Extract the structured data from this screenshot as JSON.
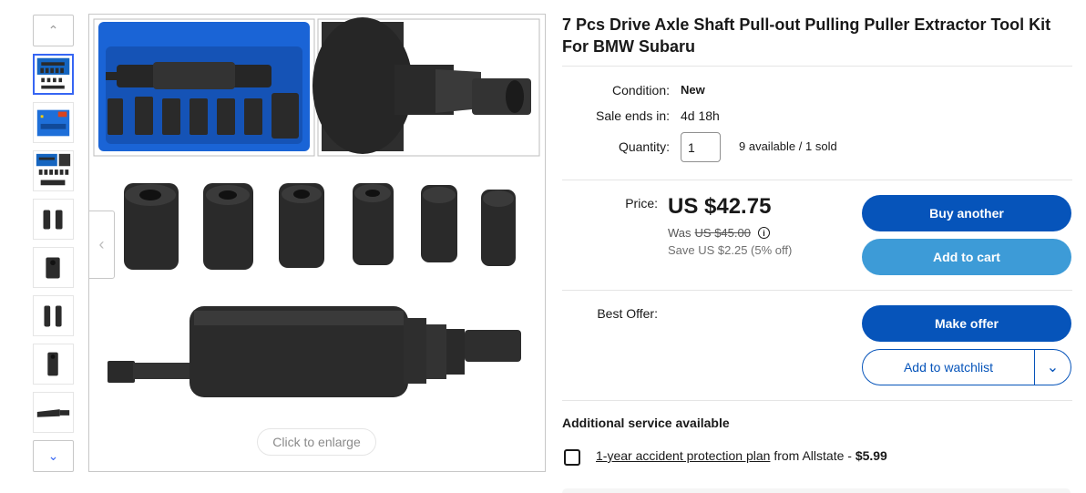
{
  "listing": {
    "title": "7 Pcs Drive Axle Shaft Pull-out Pulling Puller Extractor Tool Kit For BMW Subaru"
  },
  "gallery": {
    "up_icon": "chevron-up-icon",
    "down_icon": "chevron-down-icon",
    "prev_icon": "chevron-left-icon",
    "next_icon": "chevron-right-icon",
    "enlarge_label": "Click to enlarge",
    "thumbnails": [
      "kit-overview",
      "case-blue",
      "case-open",
      "sockets-pair",
      "socket-single",
      "sockets-pair-2",
      "socket-single-2",
      "puller-shaft"
    ]
  },
  "details": {
    "condition_label": "Condition:",
    "condition_value": "New",
    "sale_ends_label": "Sale ends in:",
    "sale_ends_value": "4d 18h",
    "quantity_label": "Quantity:",
    "quantity_value": "1",
    "availability": "9 available / 1 sold"
  },
  "price": {
    "label": "Price:",
    "current": "US $42.75",
    "was_label": "Was",
    "was_value": "US $45.00",
    "save_text": "Save US $2.25 (5% off)"
  },
  "actions": {
    "buy_another": "Buy another",
    "add_to_cart": "Add to cart",
    "best_offer_label": "Best Offer:",
    "make_offer": "Make offer",
    "add_to_watchlist": "Add to watchlist"
  },
  "services": {
    "heading": "Additional service available",
    "plan_link": "1-year accident protection plan",
    "plan_provider": " from Allstate - ",
    "plan_price": "$5.99"
  },
  "colors": {
    "primary_button": "#0654ba",
    "secondary_button": "#3d9bd7",
    "active_thumb_border": "#3665f3"
  }
}
